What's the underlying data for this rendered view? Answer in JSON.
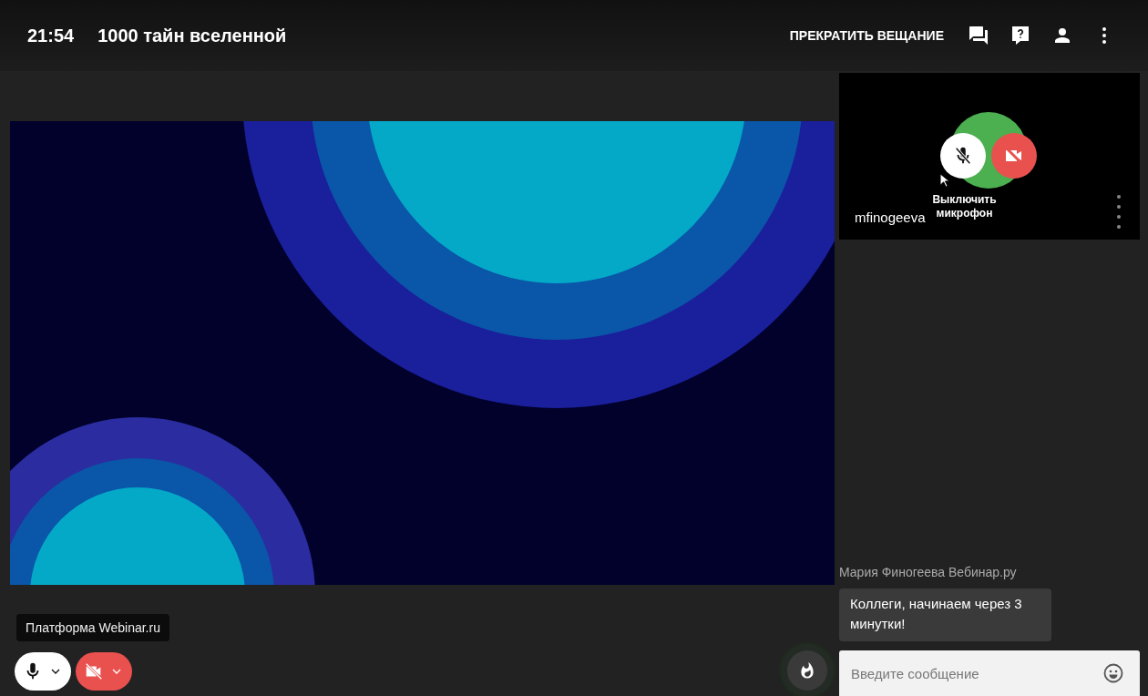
{
  "header": {
    "time": "21:54",
    "title": "1000 тайн вселенной",
    "stop_button": "ПРЕКРАТИТЬ ВЕЩАНИЕ"
  },
  "participant": {
    "name": "mfinogeeva",
    "mic_on": true,
    "camera_on": false,
    "tooltip": "Выключить микрофон"
  },
  "presenter_label": "Платформа Webinar.ru",
  "controls": {
    "mic_on": true,
    "camera_on": false
  },
  "chat": {
    "messages": [
      {
        "author": "Мария Финогеева Вебинар.ру",
        "text": "Коллеги, начинаем через 3 минутки!"
      }
    ],
    "input": {
      "placeholder": "Введите сообщение"
    }
  }
}
